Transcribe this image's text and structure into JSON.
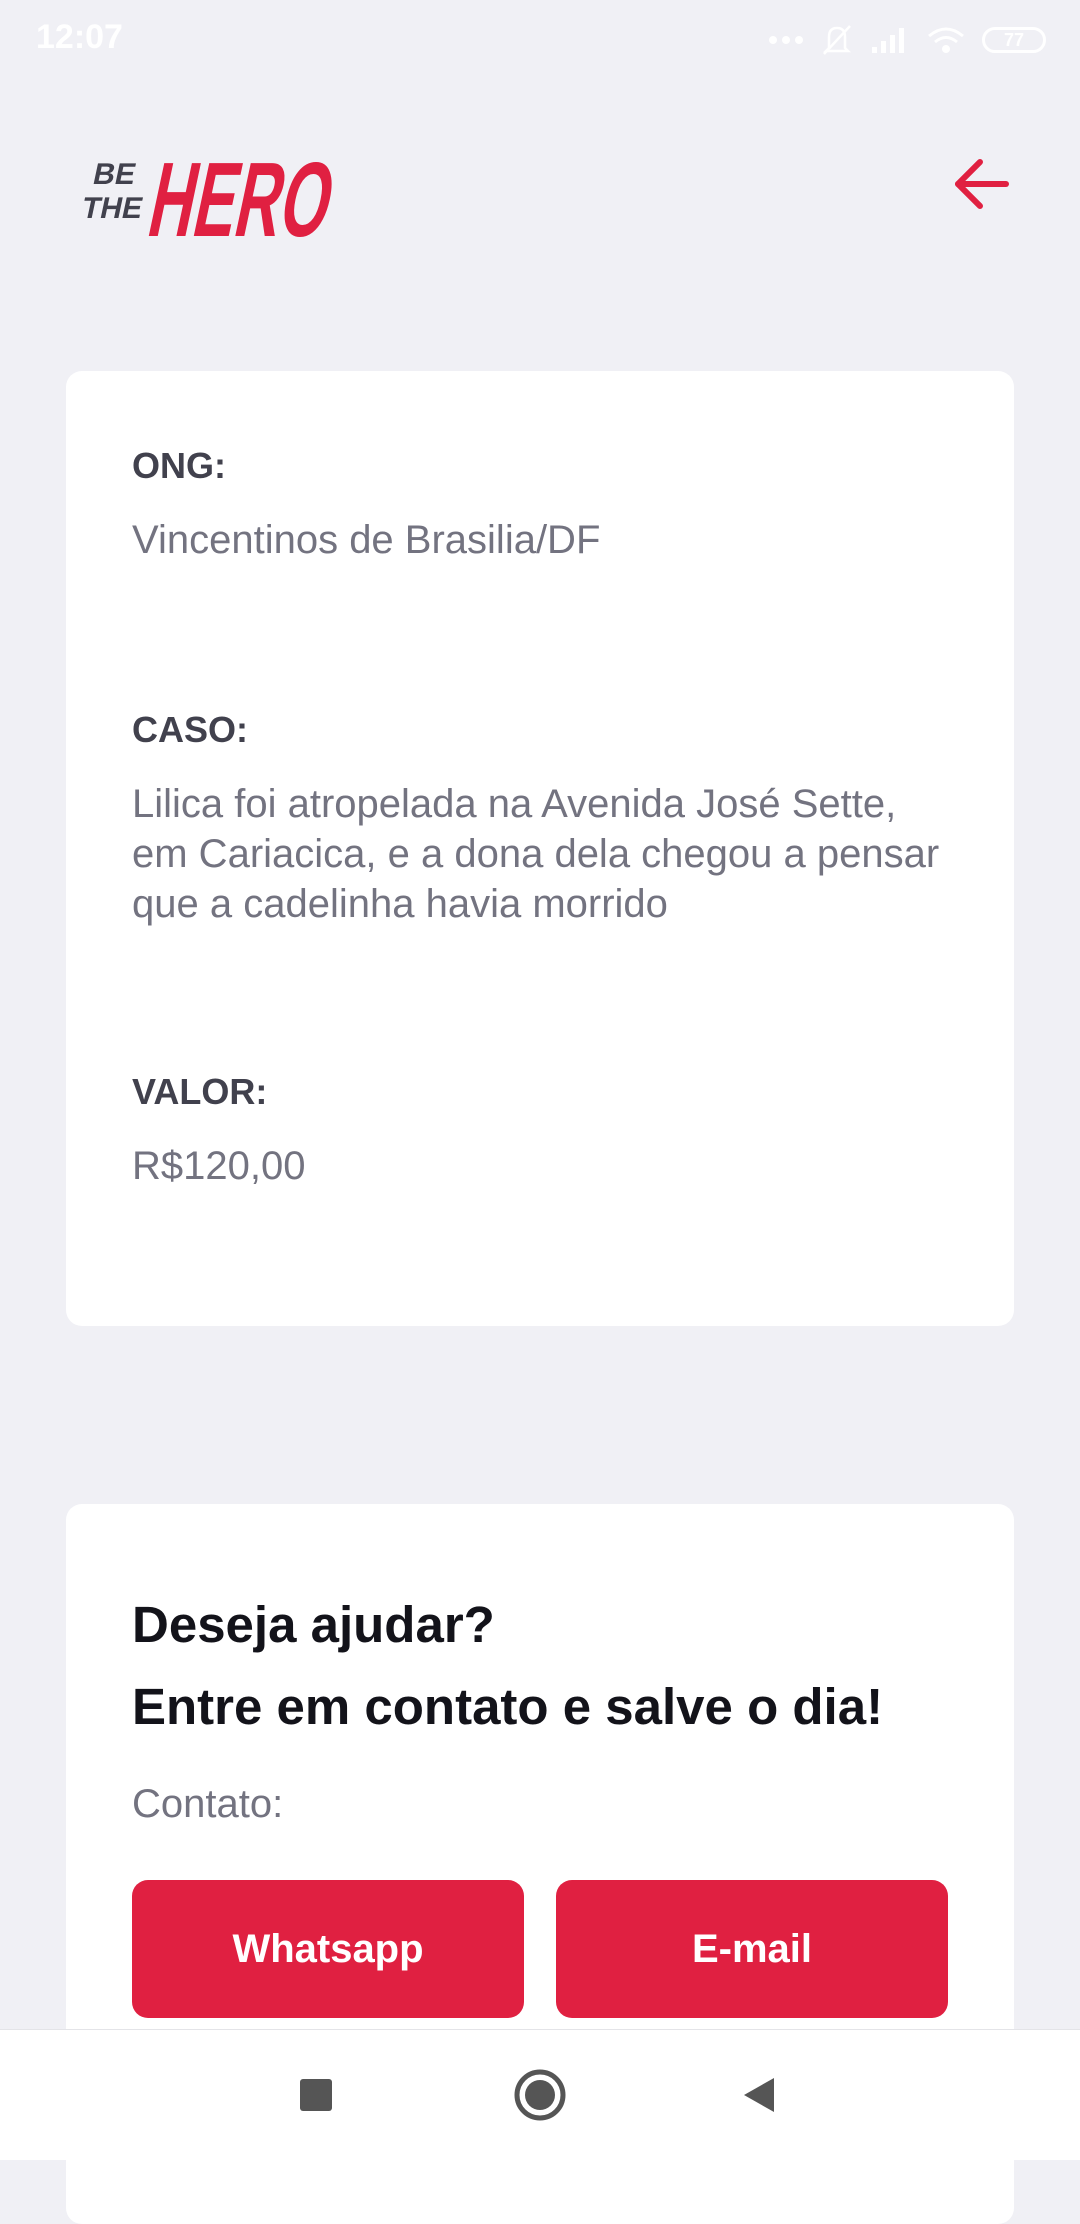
{
  "status_bar": {
    "time": "12:07",
    "battery": "77",
    "icons": [
      "more-dots-icon",
      "bell-off-icon",
      "signal-icon",
      "wifi-icon",
      "battery-icon"
    ]
  },
  "header": {
    "logo_text": [
      "BE",
      "THE",
      "HERO"
    ],
    "back_icon": "arrow-left-icon"
  },
  "incident": {
    "ong_label": "ONG:",
    "ong_value": "Vincentinos de Brasilia/DF",
    "case_label": "CASO:",
    "case_value": "Lilica foi atropelada na Avenida José Sette, em Cariacica, e a dona dela chegou a pensar que a cadelinha havia morrido",
    "value_label": "VALOR:",
    "value_value": "R$120,00"
  },
  "contact": {
    "title_line1": "Deseja ajudar?",
    "title_line2": "Entre em contato e salve o dia!",
    "label": "Contato:",
    "whatsapp_label": "Whatsapp",
    "email_label": "E-mail"
  },
  "nav_bar": {
    "icons": [
      "recents-square-icon",
      "home-circle-icon",
      "back-triangle-icon"
    ]
  },
  "colors": {
    "background": "#f0f0f5",
    "accent": "#e02041",
    "label_dark": "#41414d",
    "text_muted": "#737380",
    "title": "#13131a"
  }
}
